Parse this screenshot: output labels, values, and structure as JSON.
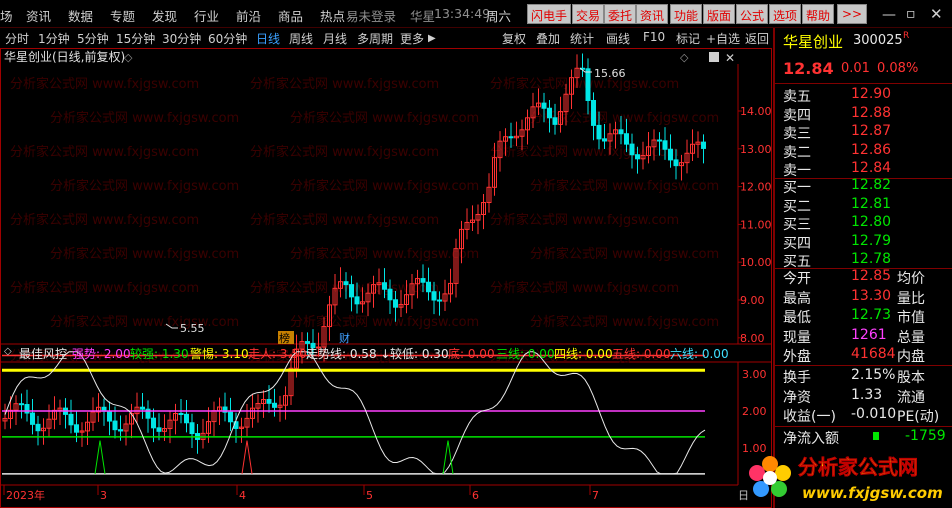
{
  "menu": {
    "items": [
      "场",
      "资讯",
      "数据",
      "专题",
      "发现",
      "行业",
      "前沿",
      "商品",
      "热点"
    ],
    "login": "易未登录",
    "stock_short": "华星",
    "time": "13:34:49",
    "weekday": "周六",
    "buttons": [
      "闪电手",
      "交易",
      "委托",
      "资讯",
      "功能",
      "版面",
      "公式",
      "选项",
      "帮助",
      ">>"
    ]
  },
  "periods": [
    "分时",
    "1分钟",
    "5分钟",
    "15分钟",
    "30分钟",
    "60分钟",
    "日线",
    "周线",
    "月线",
    "多周期",
    "更多"
  ],
  "selected_period": "日线",
  "tools": [
    "复权",
    "叠加",
    "统计",
    "画线",
    "F10",
    "标记",
    "+自选",
    "返回"
  ],
  "chart": {
    "title": "华星创业(日线,前复权)",
    "high_label": "15.66",
    "low_label": "5.55",
    "axis_ticks": [
      "14.00",
      "13.00",
      "12.00",
      "11.00",
      "10.00",
      "9.00",
      "8.00"
    ],
    "markers": [
      "榜",
      "财"
    ],
    "months": [
      "2023年",
      "3",
      "4",
      "5",
      "6",
      "7"
    ],
    "watermark": "分析家公式网 www.fxjgsw.com",
    "ind_axis": [
      "3.00",
      "2.00",
      "1.00"
    ]
  },
  "indicator": {
    "name": "最佳风控",
    "items": [
      {
        "label": "强势:",
        "value": "2.00",
        "color": "#ff40ff"
      },
      {
        "label": "较强:",
        "value": "1.30",
        "color": "#00e600"
      },
      {
        "label": "警惕:",
        "value": "3.10",
        "color": "#ffff00"
      },
      {
        "label": "走人:",
        "value": "3.50",
        "color": "#ff3232"
      },
      {
        "label": "走势线:",
        "value": "0.58",
        "color": "#e8e8e8",
        "arrow": "↓"
      },
      {
        "label": "较低:",
        "value": "0.30",
        "color": "#e8e8e8"
      },
      {
        "label": "底:",
        "value": "0.00",
        "color": "#ff3232"
      },
      {
        "label": "三线:",
        "value": "0.00",
        "color": "#00e600"
      },
      {
        "label": "四线:",
        "value": "0.00",
        "color": "#ffff00"
      },
      {
        "label": "五线:",
        "value": "0.00",
        "color": "#ff3232"
      },
      {
        "label": "六线:",
        "value": "0.00",
        "color": "#40e0ff"
      }
    ]
  },
  "quote": {
    "name": "华星创业",
    "code": "300025",
    "tag": "R",
    "price": "12.84",
    "change": "0.01",
    "pct": "0.08%",
    "asks": [
      {
        "label": "卖五",
        "price": "12.90"
      },
      {
        "label": "卖四",
        "price": "12.88"
      },
      {
        "label": "卖三",
        "price": "12.87"
      },
      {
        "label": "卖二",
        "price": "12.86"
      },
      {
        "label": "卖一",
        "price": "12.84"
      }
    ],
    "bids": [
      {
        "label": "买一",
        "price": "12.82"
      },
      {
        "label": "买二",
        "price": "12.81"
      },
      {
        "label": "买三",
        "price": "12.80"
      },
      {
        "label": "买四",
        "price": "12.79"
      },
      {
        "label": "买五",
        "price": "12.78"
      }
    ],
    "stats": [
      {
        "label": "今开",
        "value": "12.85",
        "label2": "均价",
        "color": "#ff3232"
      },
      {
        "label": "最高",
        "value": "13.30",
        "label2": "量比",
        "color": "#ff3232"
      },
      {
        "label": "最低",
        "value": "12.73",
        "label2": "市值",
        "color": "#00e600"
      },
      {
        "label": "现量",
        "value": "1261",
        "label2": "总量",
        "color": "#ff40ff"
      },
      {
        "label": "外盘",
        "value": "41684",
        "label2": "内盘",
        "color": "#ff3232"
      }
    ],
    "stats2": [
      {
        "label": "换手",
        "value": "2.15%",
        "label2": "股本"
      },
      {
        "label": "净资",
        "value": "1.33",
        "label2": "流通"
      },
      {
        "label": "收益(一)",
        "value": "-0.010",
        "label2": "PE(动)"
      }
    ],
    "flow_label": "净流入额",
    "flow_value": "-1759"
  },
  "logo": {
    "title": "分析家公式网",
    "url": "www.fxjgsw.com"
  },
  "colors": {
    "up": "#ff3232",
    "down": "#00e6e6",
    "frame": "#a00000"
  }
}
